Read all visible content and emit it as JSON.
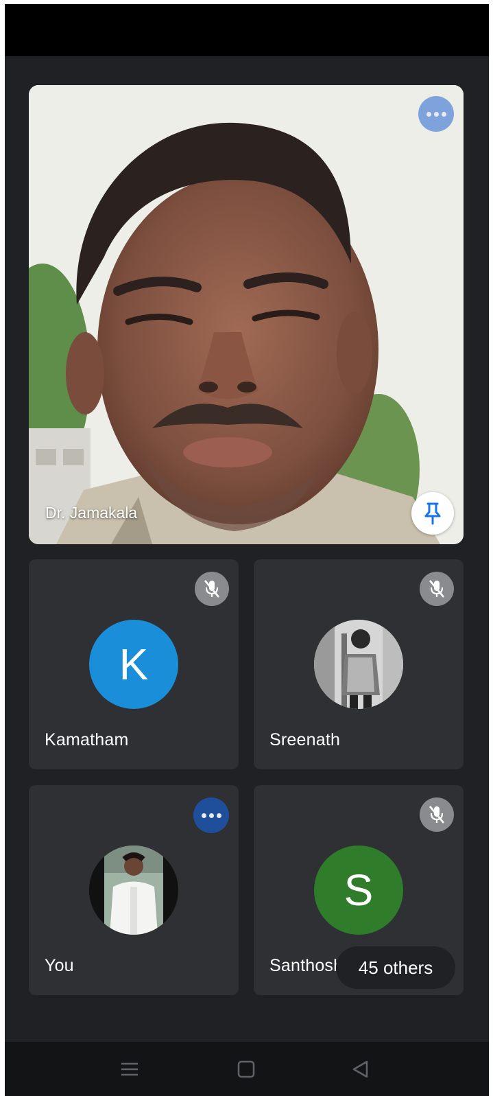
{
  "main_participant": {
    "name": "Dr. Jamakala",
    "video": "participant-video-feed",
    "more_icon": "more-options-icon",
    "pin_icon": "pin-icon"
  },
  "tiles": [
    {
      "name": "Kamatham",
      "avatar_letter": "K",
      "avatar_color": "#1a8ed8",
      "status_icon": "mic-off-icon"
    },
    {
      "name": "Sreenath",
      "avatar_type": "photo",
      "status_icon": "mic-off-icon"
    },
    {
      "name": "You",
      "avatar_type": "photo",
      "status_icon": "more-options-icon",
      "status_color": "#1f4e9a"
    },
    {
      "name": "Santhosh",
      "avatar_letter": "S",
      "avatar_color": "#2f7d2b",
      "status_icon": "mic-off-icon"
    }
  ],
  "others": {
    "label": "45 others"
  },
  "nav": {
    "buttons": [
      "menu-icon",
      "home-icon",
      "back-icon"
    ]
  },
  "colors": {
    "background": "#202124",
    "tile": "#2f3033",
    "mute_button": "#8a8b8e"
  }
}
